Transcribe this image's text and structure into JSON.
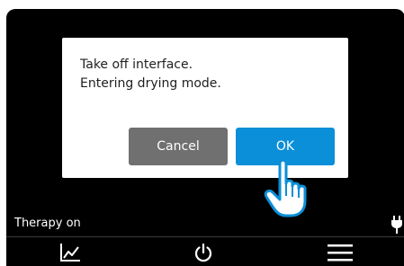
{
  "dialog": {
    "message_lines": [
      "Take off interface.",
      "Entering drying mode."
    ],
    "cancel_label": "Cancel",
    "ok_label": "OK"
  },
  "status": {
    "therapy_text": "Therapy on",
    "power_icon": "plug-icon"
  },
  "nav": {
    "items": [
      {
        "icon": "chart-icon"
      },
      {
        "icon": "power-icon"
      },
      {
        "icon": "menu-icon"
      }
    ]
  },
  "colors": {
    "screen_bg": "#000000",
    "dialog_bg": "#ffffff",
    "cancel_bg": "#707070",
    "ok_bg": "#0b8fd8",
    "text_light": "#ffffff",
    "text_dark": "#1f1f1f"
  },
  "cursor": {
    "icon": "hand-pointer-icon"
  }
}
